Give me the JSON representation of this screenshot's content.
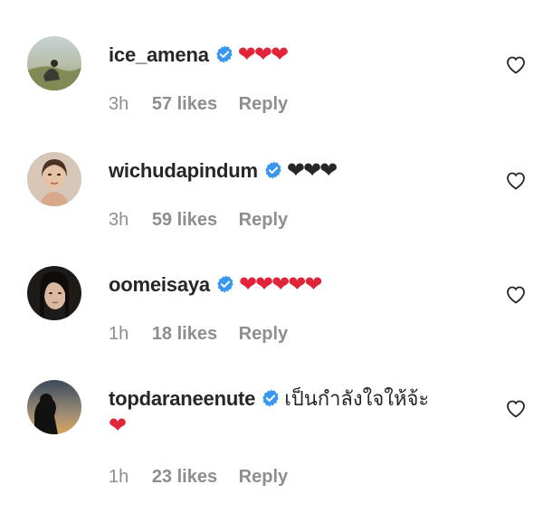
{
  "comments": [
    {
      "username": "ice_amena",
      "text": "❤❤❤",
      "text_style": "red-hearts",
      "time": "3h",
      "likes": "57 likes",
      "reply": "Reply"
    },
    {
      "username": "wichudapindum",
      "text": "❤❤❤",
      "text_style": "black-hearts",
      "time": "3h",
      "likes": "59 likes",
      "reply": "Reply"
    },
    {
      "username": "oomeisaya",
      "text": "❤❤❤❤❤",
      "text_style": "red-hearts",
      "time": "1h",
      "likes": "18 likes",
      "reply": "Reply"
    },
    {
      "username": "topdaraneenute",
      "text": "เป็นกำลังใจให้จ้ะ",
      "text_extra": "❤",
      "time": "1h",
      "likes": "23 likes",
      "reply": "Reply"
    }
  ],
  "colors": {
    "verified": "#3897f0",
    "heart_red": "#e0243a",
    "meta_gray": "#8e8e8e",
    "text": "#262626"
  },
  "icons": {
    "verified": "verified-badge-icon",
    "like": "heart-outline-icon"
  }
}
